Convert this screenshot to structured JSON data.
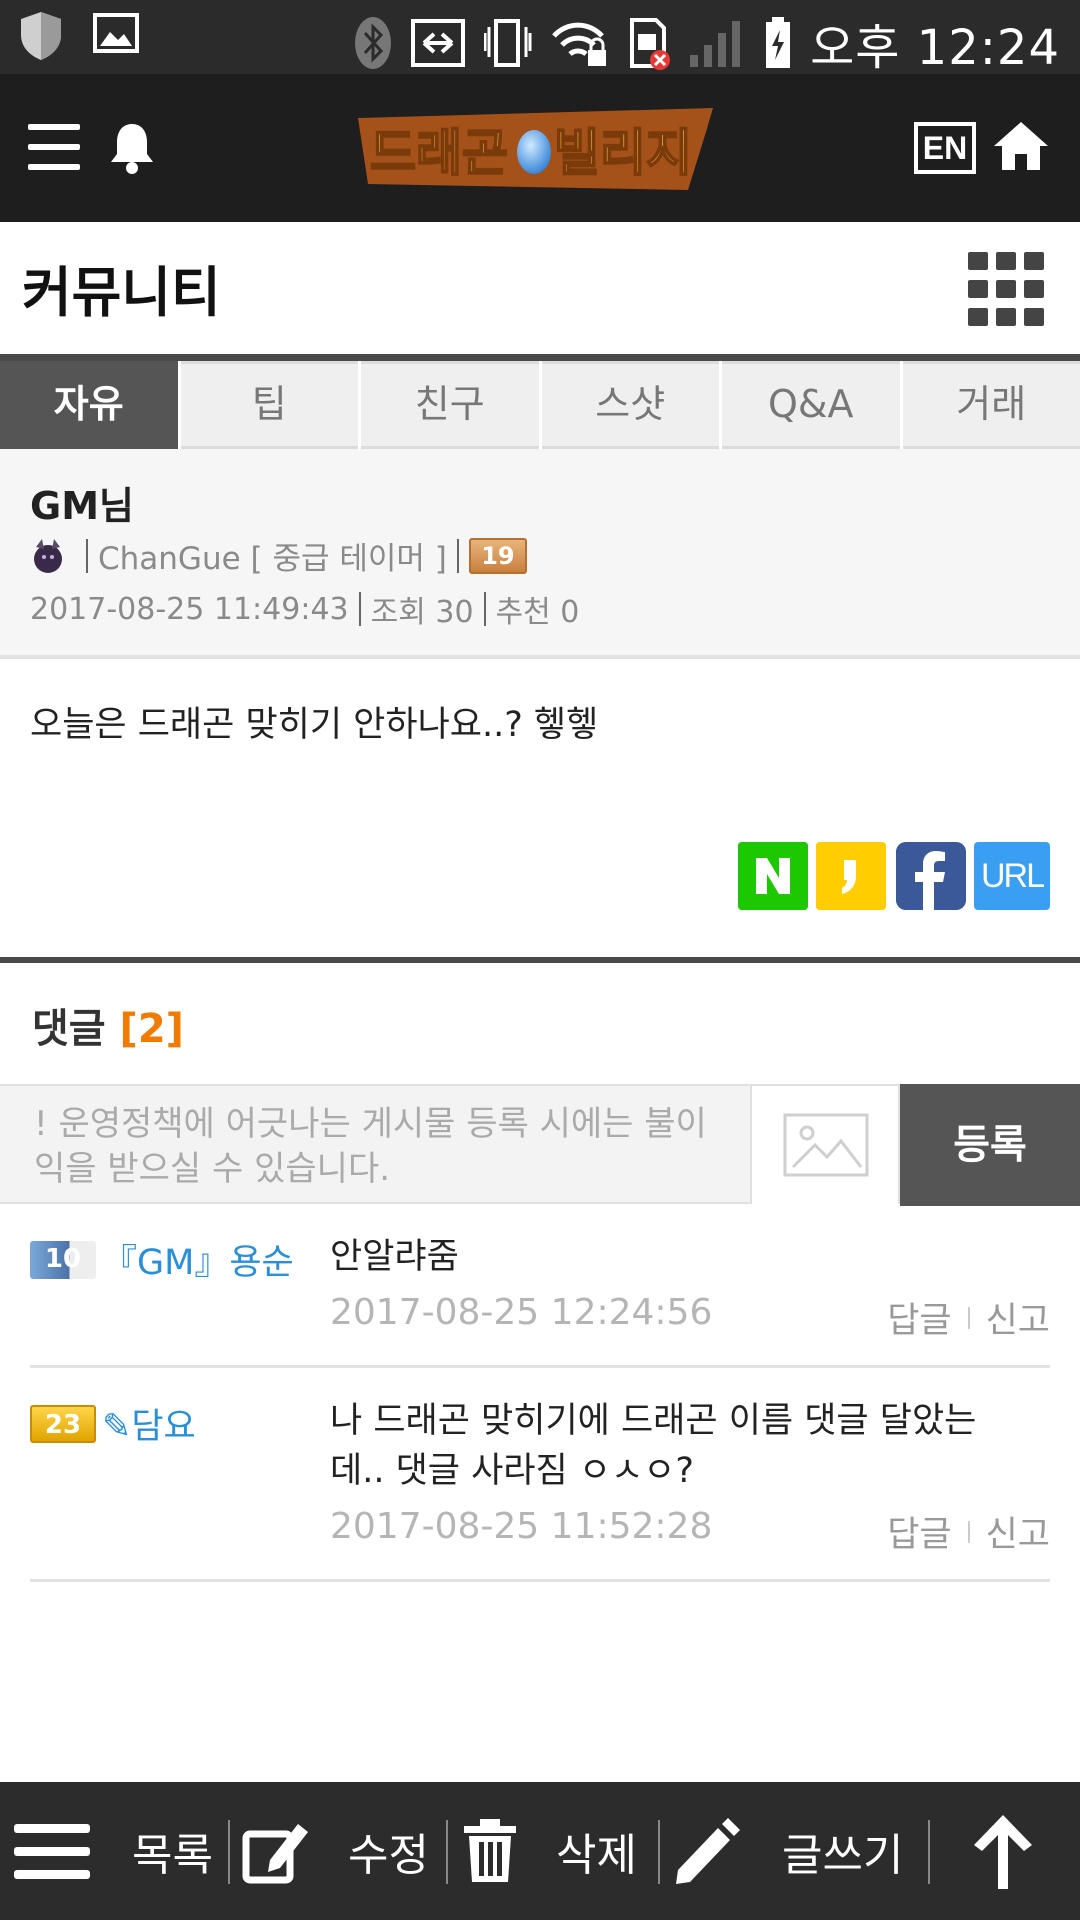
{
  "statusbar": {
    "clock": "오후 12:24"
  },
  "header": {
    "logo_text": "드래곤빌리지",
    "lang": "EN"
  },
  "page": {
    "title": "커뮤니티"
  },
  "tabs": [
    {
      "label": "자유",
      "active": true
    },
    {
      "label": "팁"
    },
    {
      "label": "친구"
    },
    {
      "label": "스샷"
    },
    {
      "label": "Q&A"
    },
    {
      "label": "거래"
    }
  ],
  "post": {
    "title": "GM님",
    "author": "ChanGue [ 중급 테이머 ]",
    "level": "19",
    "date": "2017-08-25 11:49:43",
    "views": "조회 30",
    "recommend": "추천 0",
    "body": "오늘은 드래곤 맞히기 안하나요..? 헿헿",
    "share_url_label": "URL"
  },
  "comments_section": {
    "label": "댓글",
    "count": "[2]",
    "notice": "! 운영정책에 어긋나는 게시물 등록 시에는 불이익을 받으실 수 있습니다.",
    "submit": "등록"
  },
  "comments": [
    {
      "level": "10",
      "author": "『GM』용순",
      "text": "안알랴줌",
      "date": "2017-08-25 12:24:56",
      "reply": "답글",
      "report": "신고"
    },
    {
      "level": "23",
      "author": "✎담요",
      "text": "나 드래곤 맞히기에 드래곤 이름 댓글 달았는데.. 댓글 사라짐 ㅇㅅㅇ?",
      "date": "2017-08-25 11:52:28",
      "reply": "답글",
      "report": "신고"
    }
  ],
  "bottombar": {
    "list": "목록",
    "edit": "수정",
    "delete": "삭제",
    "write": "글쓰기"
  },
  "colors": {
    "accent": "#f07b00",
    "link": "#2a8fd9",
    "header_bg": "#1e1e1e",
    "tab_active": "#555555"
  }
}
